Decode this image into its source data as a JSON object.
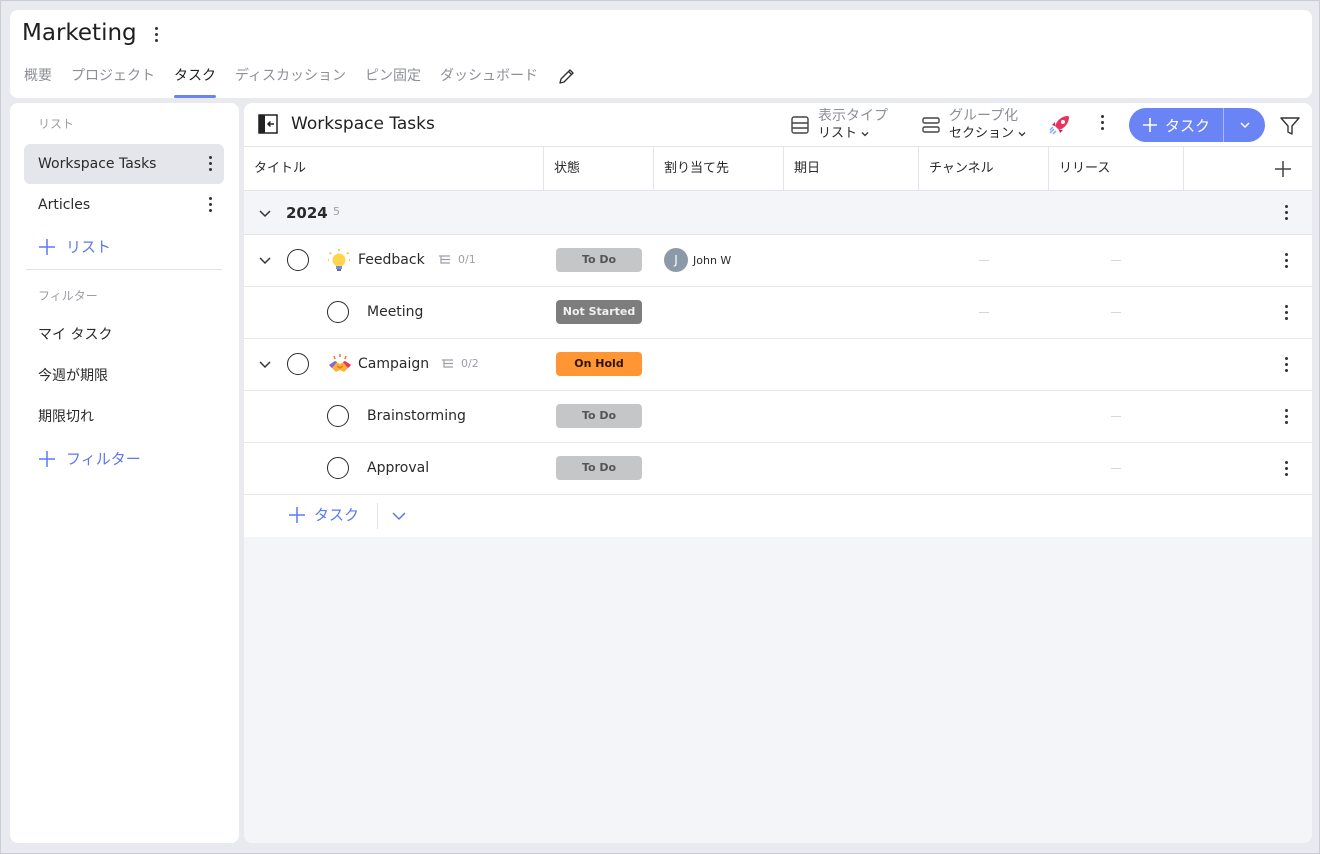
{
  "header": {
    "title": "Marketing",
    "tabs": [
      {
        "label": "概要",
        "active": false
      },
      {
        "label": "プロジェクト",
        "active": false
      },
      {
        "label": "タスク",
        "active": true
      },
      {
        "label": "ディスカッション",
        "active": false
      },
      {
        "label": "ピン固定",
        "active": false
      },
      {
        "label": "ダッシュボード",
        "active": false
      }
    ]
  },
  "sidebar": {
    "lists_label": "リスト",
    "lists": [
      {
        "label": "Workspace Tasks",
        "active": true
      },
      {
        "label": "Articles",
        "active": false
      }
    ],
    "add_list": "リスト",
    "filters_label": "フィルター",
    "filters": [
      "マイ タスク",
      "今週が期限",
      "期限切れ"
    ],
    "add_filter": "フィルター"
  },
  "toolbar": {
    "title": "Workspace Tasks",
    "view_type_label": "表示タイプ",
    "view_type_value": "リスト",
    "group_label": "グループ化",
    "group_value": "セクション",
    "add_task_label": "タスク"
  },
  "table": {
    "columns": [
      "タイトル",
      "状態",
      "割り当て先",
      "期日",
      "チャンネル",
      "リリース"
    ],
    "group": {
      "name": "2024",
      "count": "5"
    },
    "rows": [
      {
        "title": "Feedback",
        "subtasks": "0/1",
        "status": "To Do",
        "assignee": "John W",
        "assignee_initial": "J"
      },
      {
        "title": "Meeting",
        "status": "Not Started"
      },
      {
        "title": "Campaign",
        "subtasks": "0/2",
        "status": "On Hold"
      },
      {
        "title": "Brainstorming",
        "status": "To Do"
      },
      {
        "title": "Approval",
        "status": "To Do"
      }
    ],
    "add_task_label": "タスク"
  },
  "colors": {
    "accent": "#6a84f5",
    "on_hold": "#ff9633",
    "not_started": "#7d7d7d",
    "todo": "#c5c6c8"
  }
}
